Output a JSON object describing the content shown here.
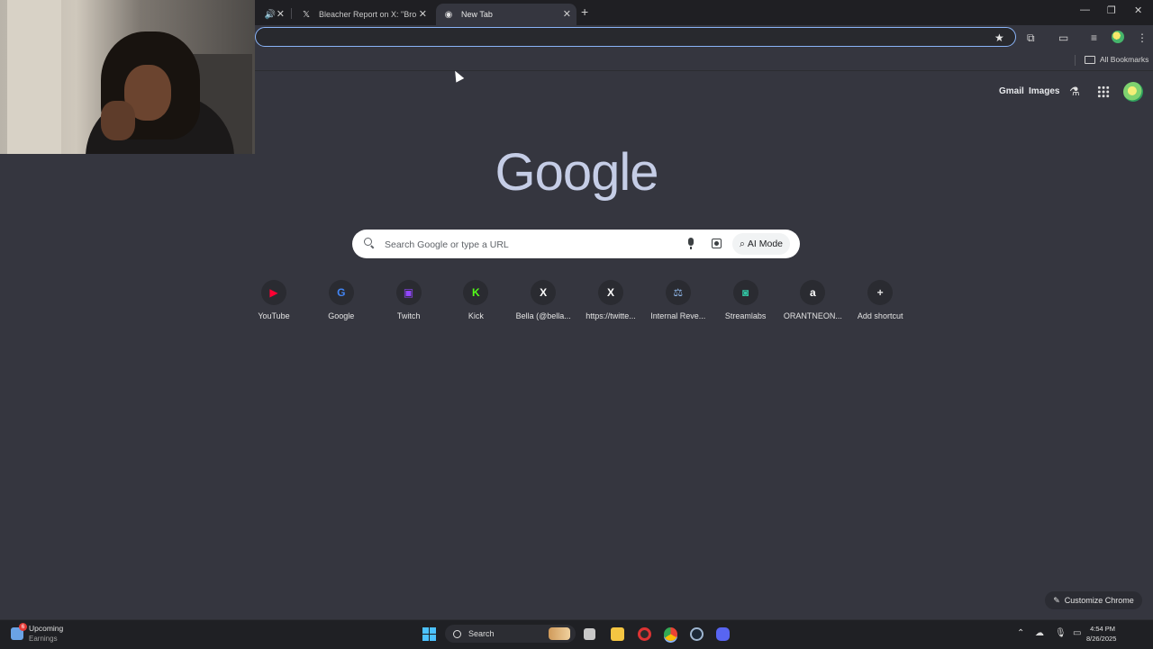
{
  "tabs": [
    {
      "title": "",
      "audio_icon": "speaker-icon"
    },
    {
      "title": "Bleacher Report on X: \"Browns",
      "favicon": "x-logo-icon"
    },
    {
      "title": "New Tab",
      "favicon": "chrome-icon",
      "active": true
    }
  ],
  "toolbar": {
    "omnibox_value": ""
  },
  "bookmarks": {
    "all_bookmarks": "All Bookmarks"
  },
  "ntp": {
    "gmail": "Gmail",
    "images": "Images",
    "logo": "Google",
    "search_placeholder": "Search Google or type a URL",
    "ai_mode": "AI Mode",
    "customize": "Customize Chrome"
  },
  "shortcuts": [
    {
      "label": "YouTube",
      "icon": "youtube-icon",
      "glyph": "▶",
      "color": "#ff0033"
    },
    {
      "label": "Google",
      "icon": "google-icon",
      "glyph": "G",
      "color": "#4285f4"
    },
    {
      "label": "Twitch",
      "icon": "twitch-icon",
      "glyph": "▣",
      "color": "#9146ff"
    },
    {
      "label": "Kick",
      "icon": "kick-icon",
      "glyph": "K",
      "color": "#53fc18"
    },
    {
      "label": "Bella (@bella...",
      "icon": "x-logo-icon",
      "glyph": "X",
      "color": "#ffffff"
    },
    {
      "label": "https://twitte...",
      "icon": "x-logo-icon",
      "glyph": "X",
      "color": "#ffffff"
    },
    {
      "label": "Internal Reve...",
      "icon": "irs-icon",
      "glyph": "⚖",
      "color": "#8fb6e8"
    },
    {
      "label": "Streamlabs",
      "icon": "streamlabs-icon",
      "glyph": "◙",
      "color": "#31c3a2"
    },
    {
      "label": "ORANTNEON...",
      "icon": "amazon-icon",
      "glyph": "a",
      "color": "#ffffff"
    },
    {
      "label": "Add shortcut",
      "icon": "plus-icon",
      "glyph": "+",
      "color": "#e3e3e3"
    }
  ],
  "taskbar": {
    "widget_badge": "6",
    "widget_title": "Upcoming",
    "widget_subtitle": "Earnings",
    "search_label": "Search",
    "time": "4:54 PM",
    "date": "8/26/2025"
  }
}
